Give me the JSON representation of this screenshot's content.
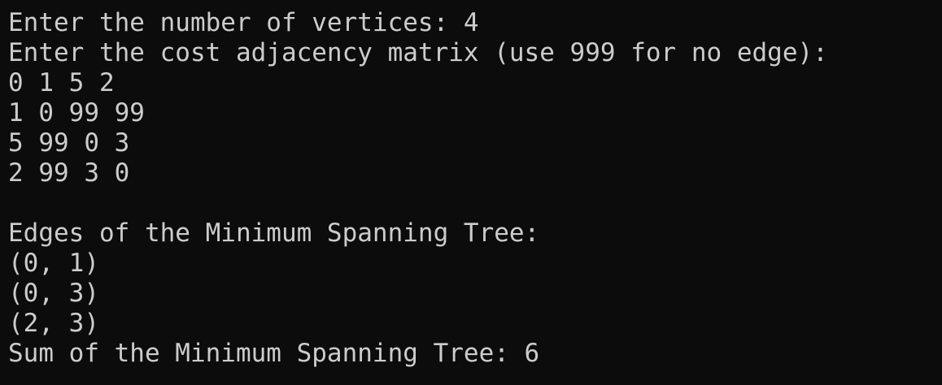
{
  "terminal": {
    "lines": [
      "Enter the number of vertices: 4",
      "Enter the cost adjacency matrix (use 999 for no edge):",
      "0 1 5 2",
      "1 0 99 99",
      "5 99 0 3",
      "2 99 3 0",
      "",
      "Edges of the Minimum Spanning Tree:",
      "(0, 1)",
      "(0, 3)",
      "(2, 3)",
      "Sum of the Minimum Spanning Tree: 6"
    ]
  },
  "colors": {
    "background": "#0c0c0c",
    "foreground": "#cccccc"
  }
}
